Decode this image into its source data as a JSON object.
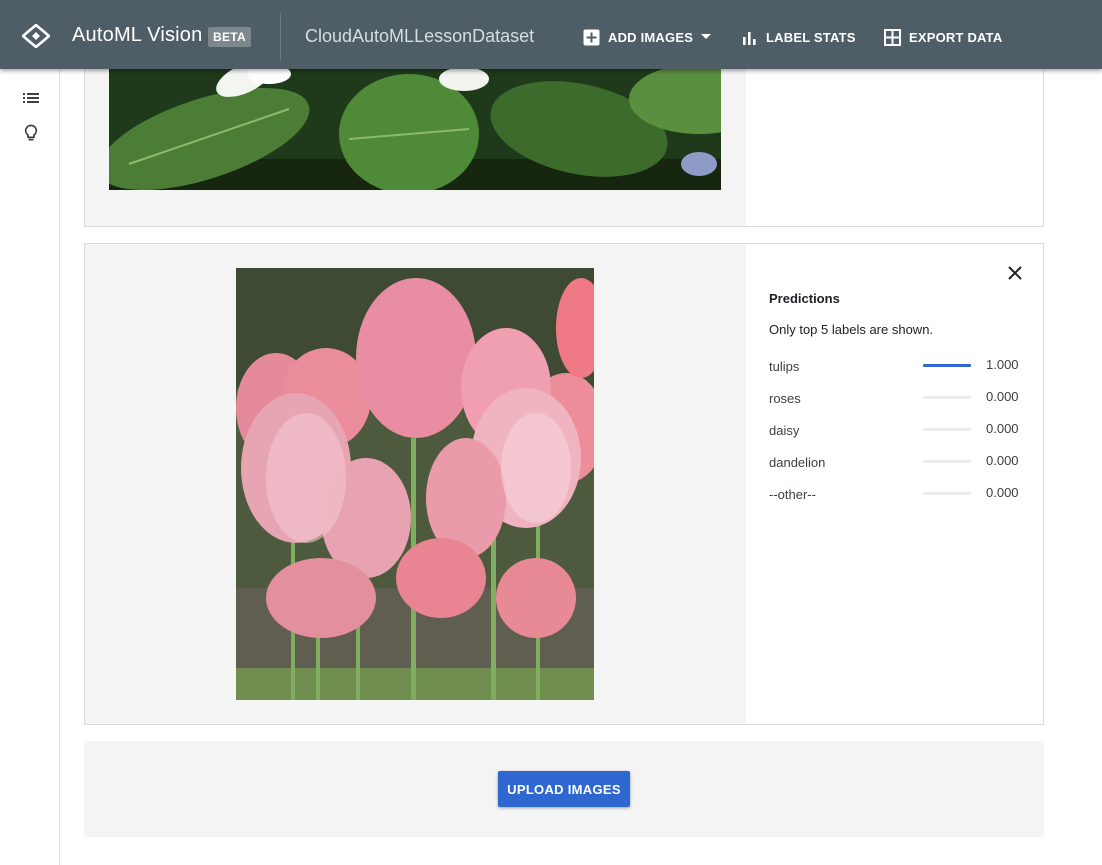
{
  "header": {
    "app_title": "AutoML Vision",
    "badge": "BETA",
    "dataset_name": "CloudAutoMLLessonDataset",
    "actions": [
      {
        "label": "ADD IMAGES",
        "icon": "add-box-icon"
      },
      {
        "label": "LABEL STATS",
        "icon": "bar-chart-icon"
      },
      {
        "label": "EXPORT DATA",
        "icon": "grid-icon"
      }
    ]
  },
  "sidebar": {
    "items": [
      {
        "icon": "list-icon"
      },
      {
        "icon": "lightbulb-icon"
      }
    ]
  },
  "predictions": {
    "title": "Predictions",
    "note": "Only top 5 labels are shown.",
    "rows": [
      {
        "label": "tulips",
        "score": "1.000",
        "value": 1.0
      },
      {
        "label": "roses",
        "score": "0.000",
        "value": 0.0
      },
      {
        "label": "daisy",
        "score": "0.000",
        "value": 0.0
      },
      {
        "label": "dandelion",
        "score": "0.000",
        "value": 0.0
      },
      {
        "label": "--other--",
        "score": "0.000",
        "value": 0.0
      }
    ]
  },
  "upload": {
    "button_label": "UPLOAD IMAGES"
  },
  "colors": {
    "header_bg": "#4f5d66",
    "accent": "#2f67d1",
    "panel_bg": "#f4f4f4"
  }
}
